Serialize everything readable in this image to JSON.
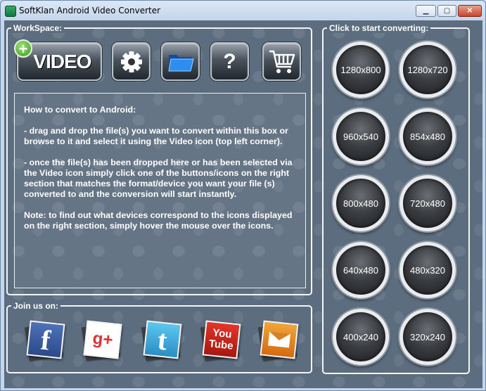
{
  "window": {
    "title": "SoftKlan Android Video Converter",
    "minimize_glyph": "▁",
    "maximize_glyph": "▢",
    "close_glyph": "✕"
  },
  "workspace": {
    "title": "WorkSpace:",
    "tools": {
      "video_label": "VIDEO",
      "plus_glyph": "+",
      "help_glyph": "?"
    },
    "instructions": {
      "heading": "How to convert to Android:",
      "step1": "- drag and drop the file(s) you want to convert within this box or browse to it and select it using the Video icon (top left corner).",
      "step2": "- once the file(s) has been dropped here or has been selected via the Video icon simply click one of the buttons/icons on the right section that matches the format/device you want your file (s) converted to and the conversion will start instantly.",
      "note": "Note: to find out what devices correspond to the icons displayed on the right section, simply hover the mouse over the icons."
    }
  },
  "join": {
    "title": "Join us on:",
    "facebook_glyph": "f",
    "googleplus_glyph": "g+",
    "twitter_glyph": "t",
    "youtube_line1": "You",
    "youtube_line2": "Tube"
  },
  "convert": {
    "title": "Click to start converting:",
    "resolutions": [
      "1280x800",
      "1280x720",
      "960x540",
      "854x480",
      "800x480",
      "720x480",
      "640x480",
      "480x320",
      "400x240",
      "320x240"
    ]
  }
}
